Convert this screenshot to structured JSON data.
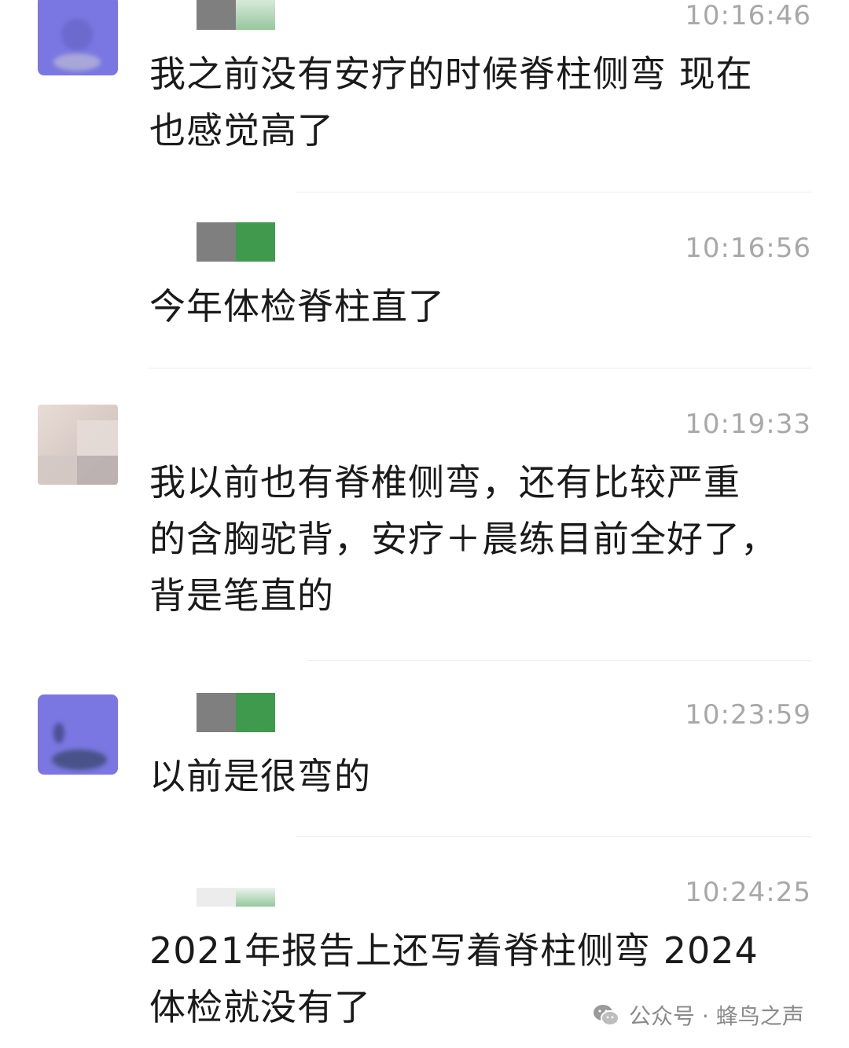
{
  "messages": [
    {
      "time": "10:16:46",
      "text": "我之前没有安疗的时候脊柱侧弯 现在\n也感觉高了"
    },
    {
      "time": "10:16:56",
      "text": "今年体检脊柱直了"
    },
    {
      "time": "10:19:33",
      "text": "我以前也有脊椎侧弯，还有比较严重\n的含胸驼背，安疗＋晨练目前全好了，\n背是笔直的"
    },
    {
      "time": "10:23:59",
      "text": "以前是很弯的"
    },
    {
      "time": "10:24:25",
      "text": "2021年报告上还写着脊柱侧弯 2024\n体检就没有了"
    }
  ],
  "watermark": {
    "label": "公众号 · 蜂鸟之声",
    "icon": "wechat-icon"
  }
}
